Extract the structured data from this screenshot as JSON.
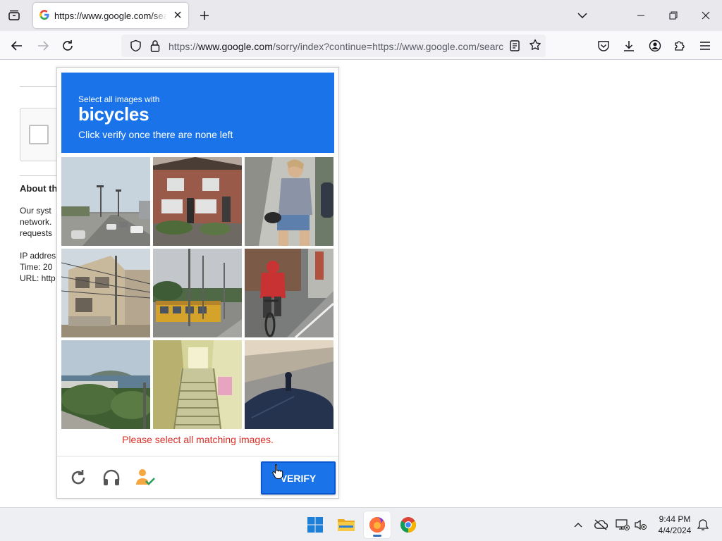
{
  "browser": {
    "tab_title": "https://www.google.com/search",
    "tab_favicon": "google-g-icon",
    "url_domain": "www.google.com",
    "url_prefix": "https://",
    "url_suffix": "/sorry/index?continue=https://www.google.com/search"
  },
  "background_page": {
    "section_heading": "About th",
    "para_line1": "Our syst",
    "para_line2": "network.",
    "para_line3": "requests",
    "ip_label": "IP addres",
    "time_label": "Time: 20",
    "url_label": "URL: http"
  },
  "captcha": {
    "instruction_line1": "Select all images with",
    "target_object": "bicycles",
    "instruction_line3": "Click verify once there are none left",
    "error_message": "Please select all matching images.",
    "verify_label": "VERIFY",
    "tiles": [
      "street-with-traffic-lights-and-cars",
      "brick-row-houses",
      "woman-in-denim-shorts-walking",
      "house-with-power-lines",
      "street-with-yellow-bus",
      "person-in-red-jacket-riding-bicycle",
      "coastal-town-view",
      "stairway-in-corridor",
      "road-with-dark-object-foreground"
    ],
    "header_color": "#1a73e8",
    "error_color": "#d93025"
  },
  "taskbar": {
    "time": "9:44 PM",
    "date": "4/4/2024",
    "apps": [
      "windows-start-icon",
      "file-explorer-icon",
      "firefox-icon",
      "chrome-icon"
    ]
  }
}
